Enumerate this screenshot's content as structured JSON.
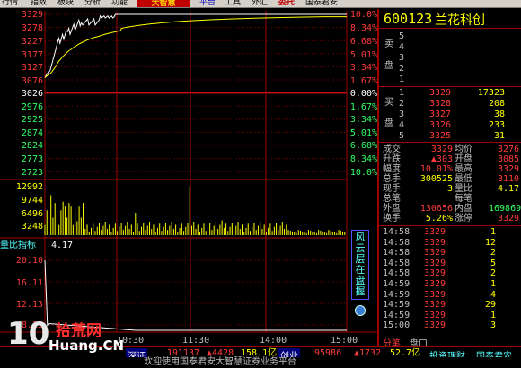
{
  "menu": {
    "items": [
      "行情",
      "指数",
      "板块",
      "分析",
      "功能",
      "大智慧",
      "平台",
      "工具",
      "外汇",
      "委托",
      "国泰君安"
    ],
    "brand": "大智慧"
  },
  "price_axis": {
    "left": [
      "3329",
      "3278",
      "3227",
      "3177",
      "3127",
      "3076",
      "3026",
      "2976",
      "2925",
      "2874",
      "2824",
      "2773",
      "2723"
    ],
    "right": [
      "10.0%",
      "8.34%",
      "6.68%",
      "5.01%",
      "3.34%",
      "1.67%",
      "0.00%",
      "1.67%",
      "3.34%",
      "5.01%",
      "6.68%",
      "8.34%",
      "10.0%"
    ]
  },
  "volume_axis": [
    "12992",
    "9744",
    "6496",
    "3248"
  ],
  "indicator": {
    "name": "量比指标",
    "value": "4.17",
    "axis": [
      "20.10",
      "16.11",
      "12.13",
      "8.15"
    ]
  },
  "time_axis": [
    "10:30",
    "11:30",
    "14:00",
    "15:00"
  ],
  "side_tabs": [
    "风云",
    "层在",
    "盘",
    "握"
  ],
  "stock": {
    "code": "600123",
    "name": "兰花科创"
  },
  "order_book": {
    "sell_label": [
      "卖",
      "盘"
    ],
    "buy_label": [
      "买",
      "盘"
    ],
    "sell": [
      {
        "level": "5",
        "price": "",
        "vol": ""
      },
      {
        "level": "4",
        "price": "",
        "vol": ""
      },
      {
        "level": "3",
        "price": "",
        "vol": ""
      },
      {
        "level": "2",
        "price": "",
        "vol": ""
      },
      {
        "level": "1",
        "price": "",
        "vol": ""
      }
    ],
    "buy": [
      {
        "level": "1",
        "price": "3329",
        "vol": "17323"
      },
      {
        "level": "2",
        "price": "3328",
        "vol": "208"
      },
      {
        "level": "3",
        "price": "3327",
        "vol": "38"
      },
      {
        "level": "4",
        "price": "3326",
        "vol": "233"
      },
      {
        "level": "5",
        "price": "3325",
        "vol": "31"
      }
    ]
  },
  "stats": [
    {
      "l1": "成交",
      "v1": "3329",
      "l2": "均价",
      "v2": "3276"
    },
    {
      "l1": "升跌",
      "v1": "▲303",
      "l2": "开盘",
      "v2": "3085"
    },
    {
      "l1": "幅度",
      "v1": "10.01%",
      "l2": "最高",
      "v2": "3329"
    },
    {
      "l1": "总手",
      "v1": "300525",
      "l2": "最低",
      "v2": "3110"
    },
    {
      "l1": "现手",
      "v1": "3",
      "l2": "量比",
      "v2": "4.17"
    },
    {
      "l1": "总笔",
      "v1": "",
      "l2": "每笔",
      "v2": ""
    },
    {
      "l1": "外盘",
      "v1": "130656",
      "l2": "内盘",
      "v2": "169869"
    },
    {
      "l1": "换手",
      "v1": "5.26%",
      "l2": "涨停",
      "v2": "3329"
    }
  ],
  "ticks": [
    {
      "time": "14:58",
      "price": "3329",
      "vol": "1"
    },
    {
      "time": "14:58",
      "price": "3329",
      "vol": "12"
    },
    {
      "time": "14:58",
      "price": "3329",
      "vol": "2"
    },
    {
      "time": "14:58",
      "price": "3329",
      "vol": "5"
    },
    {
      "time": "14:58",
      "price": "3329",
      "vol": "2"
    },
    {
      "time": "14:59",
      "price": "3329",
      "vol": "1"
    },
    {
      "time": "14:59",
      "price": "3329",
      "vol": "4"
    },
    {
      "time": "14:59",
      "price": "3329",
      "vol": "29"
    },
    {
      "time": "14:59",
      "price": "3329",
      "vol": "1"
    },
    {
      "time": "15:00",
      "price": "3329",
      "vol": "3"
    }
  ],
  "panel_tabs": [
    "分笔",
    "盘口"
  ],
  "status": {
    "index1_name": "深证",
    "index1_val": "191137",
    "index1_chg": "▲4428",
    "index1_pct": "158.1亿",
    "index2_name": "创业",
    "index2_val": "95986",
    "index2_chg": "▲1732",
    "index2_pct": "52.7亿",
    "links": [
      "投资理财",
      "国泰君安"
    ],
    "welcome": "欢迎使用国泰君安大智慧证券业务平台"
  },
  "watermark": {
    "number": "10",
    "cn": "拾荒网",
    "site": "Huang.CN"
  },
  "colors": {
    "up": "#ff3b3b",
    "down": "#33ff66",
    "price_line": "#ffffff",
    "avg_line": "#ffff00",
    "grid": "#a00000",
    "volume": "#ffff00"
  }
}
